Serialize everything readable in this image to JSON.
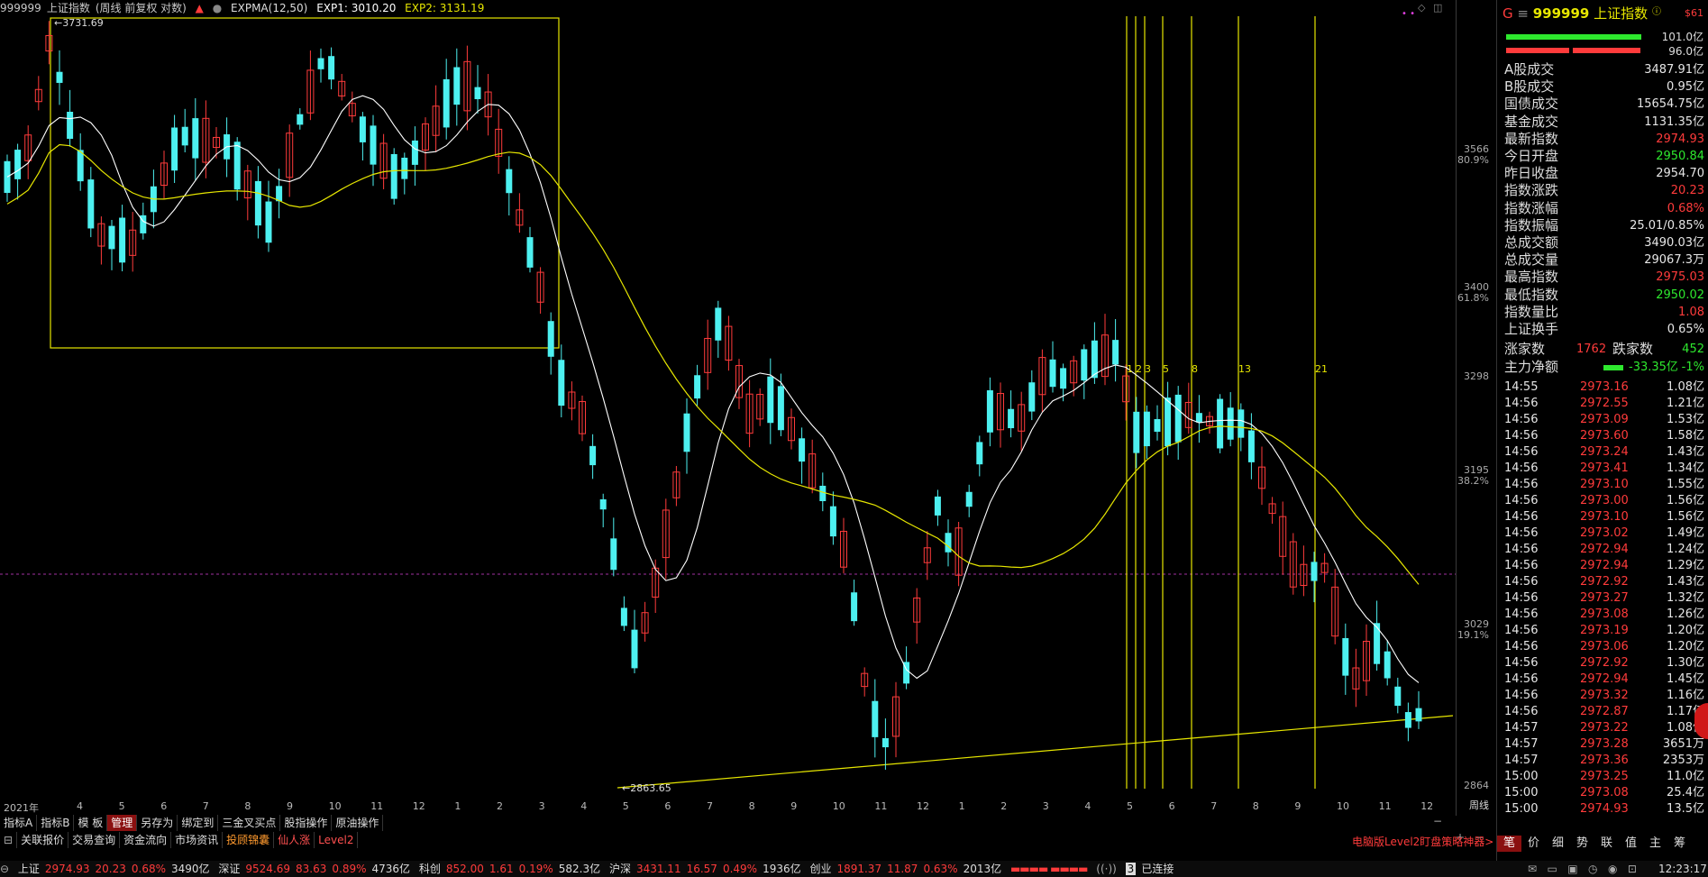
{
  "header": {
    "code": "999999",
    "name": "上证指数",
    "mode": "(周线 前复权 对数)",
    "indicator": "EXPMA(12,50)",
    "exp1": "EXP1: 3010.20",
    "exp2": "EXP2: 3131.19"
  },
  "chart_annotations": {
    "high_label": "3731.69",
    "low_label": "2863.65",
    "year_label": "2021年",
    "fib_labels": [
      "1",
      "2",
      "3",
      "5",
      "8",
      "13",
      "21"
    ]
  },
  "price_axis": [
    {
      "price": "3566",
      "pct": "80.9%"
    },
    {
      "price": "3400",
      "pct": "61.8%"
    },
    {
      "price": "3298",
      "pct": ""
    },
    {
      "price": "3195",
      "pct": "38.2%"
    },
    {
      "price": "3029",
      "pct": "19.1%"
    },
    {
      "price": "2864",
      "pct": ""
    }
  ],
  "months": [
    "4",
    "5",
    "6",
    "7",
    "8",
    "9",
    "10",
    "11",
    "12",
    "1",
    "2",
    "3",
    "4",
    "5",
    "6",
    "7",
    "8",
    "9",
    "10",
    "11",
    "12",
    "1",
    "2",
    "3",
    "4",
    "5",
    "6",
    "7",
    "8",
    "9",
    "10",
    "11",
    "12"
  ],
  "period_label": "周线",
  "toolbar1": [
    "指标A",
    "指标B",
    "模 板",
    "管理",
    "另存为",
    "绑定到",
    "三金叉买点",
    "股指操作",
    "原油操作"
  ],
  "toolbar2": [
    "关联报价",
    "交易查询",
    "资金流向",
    "市场资讯",
    "投顾锦囊",
    "仙人涨",
    "Level2"
  ],
  "promo": "电脑版Level2盯盘策略神器>",
  "panel": {
    "title_code": "999999",
    "title_name": "上证指数",
    "badge": "$61",
    "bar1_value": "101.0亿",
    "bar2_value": "96.0亿",
    "stats": [
      {
        "k": "A股成交",
        "v": "3487.91亿",
        "c": "white"
      },
      {
        "k": "B股成交",
        "v": "0.95亿",
        "c": "white"
      },
      {
        "k": "国债成交",
        "v": "15654.75亿",
        "c": "white"
      },
      {
        "k": "基金成交",
        "v": "1131.35亿",
        "c": "white"
      },
      {
        "k": "最新指数",
        "v": "2974.93",
        "c": "red"
      },
      {
        "k": "今日开盘",
        "v": "2950.84",
        "c": "green"
      },
      {
        "k": "昨日收盘",
        "v": "2954.70",
        "c": "white"
      },
      {
        "k": "指数涨跌",
        "v": "20.23",
        "c": "red"
      },
      {
        "k": "指数涨幅",
        "v": "0.68%",
        "c": "red"
      },
      {
        "k": "指数振幅",
        "v": "25.01/0.85%",
        "c": "white"
      },
      {
        "k": "总成交额",
        "v": "3490.03亿",
        "c": "white"
      },
      {
        "k": "总成交量",
        "v": "29067.3万",
        "c": "white"
      },
      {
        "k": "最高指数",
        "v": "2975.03",
        "c": "red"
      },
      {
        "k": "最低指数",
        "v": "2950.02",
        "c": "green"
      },
      {
        "k": "指数量比",
        "v": "1.08",
        "c": "red"
      },
      {
        "k": "上证换手",
        "v": "0.65%",
        "c": "white"
      }
    ],
    "up_label": "涨家数",
    "up_value": "1762",
    "down_label": "跌家数",
    "down_value": "452",
    "net_label": "主力净额",
    "net_value": "-33.35亿",
    "net_pct": "-1%",
    "ticks": [
      {
        "t": "14:55",
        "p": "2973.16",
        "q": "1.08亿"
      },
      {
        "t": "14:56",
        "p": "2972.55",
        "q": "1.21亿"
      },
      {
        "t": "14:56",
        "p": "2973.09",
        "q": "1.53亿"
      },
      {
        "t": "14:56",
        "p": "2973.60",
        "q": "1.58亿"
      },
      {
        "t": "14:56",
        "p": "2973.24",
        "q": "1.43亿"
      },
      {
        "t": "14:56",
        "p": "2973.41",
        "q": "1.34亿"
      },
      {
        "t": "14:56",
        "p": "2973.10",
        "q": "1.55亿"
      },
      {
        "t": "14:56",
        "p": "2973.00",
        "q": "1.56亿"
      },
      {
        "t": "14:56",
        "p": "2973.10",
        "q": "1.56亿"
      },
      {
        "t": "14:56",
        "p": "2973.02",
        "q": "1.49亿"
      },
      {
        "t": "14:56",
        "p": "2972.94",
        "q": "1.24亿"
      },
      {
        "t": "14:56",
        "p": "2972.94",
        "q": "1.29亿"
      },
      {
        "t": "14:56",
        "p": "2972.92",
        "q": "1.43亿"
      },
      {
        "t": "14:56",
        "p": "2973.27",
        "q": "1.32亿"
      },
      {
        "t": "14:56",
        "p": "2973.08",
        "q": "1.26亿"
      },
      {
        "t": "14:56",
        "p": "2973.19",
        "q": "1.20亿"
      },
      {
        "t": "14:56",
        "p": "2973.06",
        "q": "1.20亿"
      },
      {
        "t": "14:56",
        "p": "2972.92",
        "q": "1.30亿"
      },
      {
        "t": "14:56",
        "p": "2972.94",
        "q": "1.45亿"
      },
      {
        "t": "14:56",
        "p": "2973.32",
        "q": "1.16亿"
      },
      {
        "t": "14:56",
        "p": "2972.87",
        "q": "1.17亿"
      },
      {
        "t": "14:57",
        "p": "2973.22",
        "q": "1.08亿"
      },
      {
        "t": "14:57",
        "p": "2973.28",
        "q": "3651万"
      },
      {
        "t": "14:57",
        "p": "2973.36",
        "q": "2353万"
      },
      {
        "t": "15:00",
        "p": "2973.25",
        "q": "11.0亿"
      },
      {
        "t": "15:00",
        "p": "2973.08",
        "q": "25.4亿"
      },
      {
        "t": "15:00",
        "p": "2974.93",
        "q": "13.5亿"
      }
    ],
    "tabs": [
      "笔",
      "价",
      "细",
      "势",
      "联",
      "值",
      "主",
      "筹"
    ]
  },
  "status": {
    "sh_label": "上证",
    "sh_val": "2974.93",
    "sh_chg": "20.23",
    "sh_pct": "0.68%",
    "sh_amt": "3490亿",
    "sz_label": "深证",
    "sz_val": "9524.69",
    "sz_chg": "83.63",
    "sz_pct": "0.89%",
    "sz_amt": "4736亿",
    "kc_label": "科创",
    "kc_val": "852.00",
    "kc_chg": "1.61",
    "kc_pct": "0.19%",
    "kc_amt": "582.3亿",
    "hs_label": "沪深",
    "hs_val": "3431.11",
    "hs_chg": "16.57",
    "hs_pct": "0.49%",
    "hs_amt": "1936亿",
    "cy_label": "创业",
    "cy_val": "1891.37",
    "cy_chg": "11.87",
    "cy_pct": "0.63%",
    "cy_amt": "2013亿",
    "conn_num": "3",
    "conn": "已连接",
    "clock": "12:23:17"
  },
  "colors": {
    "up": "#ff3b3b",
    "down": "#4df0f0",
    "ma1": "#ffffff",
    "ma2": "#e6e600"
  }
}
